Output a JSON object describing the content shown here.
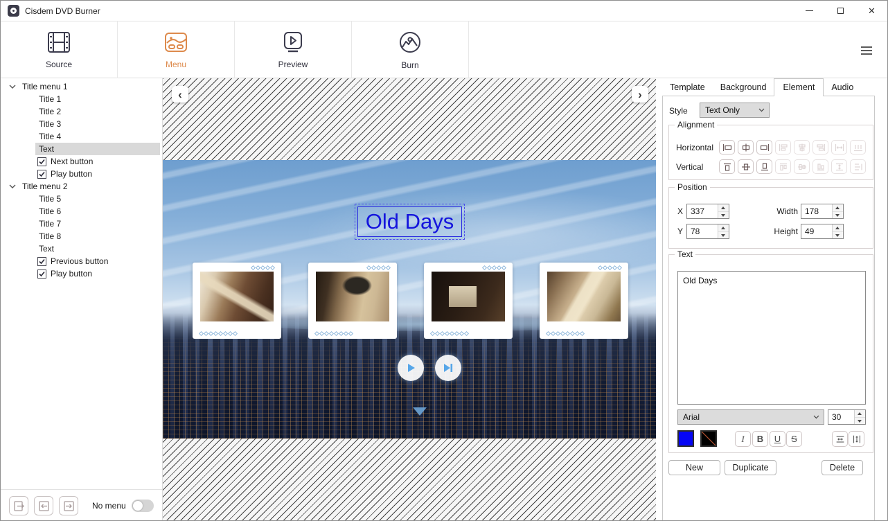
{
  "window": {
    "title": "Cisdem DVD Burner",
    "controls": [
      "minimize-icon",
      "maximize-icon",
      "close-icon"
    ]
  },
  "toolbar": {
    "items": [
      {
        "label": "Source",
        "icon": "filmstrip-icon",
        "active": false
      },
      {
        "label": "Menu",
        "icon": "image-menu-icon",
        "active": true
      },
      {
        "label": "Preview",
        "icon": "play-screen-icon",
        "active": false
      },
      {
        "label": "Burn",
        "icon": "disc-burn-icon",
        "active": false
      }
    ],
    "more_icon": "hamburger-icon"
  },
  "colors": {
    "accent_orange": "#dd8a4c",
    "selection_gray": "#d9d9d9",
    "menu_title_blue": "#1414dd"
  },
  "tree": {
    "groups": [
      {
        "label": "Title menu 1",
        "expanded": true,
        "children": [
          {
            "label": "Title 1"
          },
          {
            "label": "Title 2"
          },
          {
            "label": "Title 3"
          },
          {
            "label": "Title 4"
          },
          {
            "label": "Text",
            "selected": true
          },
          {
            "label": "Next button",
            "checkbox": true,
            "checked": true
          },
          {
            "label": "Play button",
            "checkbox": true,
            "checked": true
          }
        ]
      },
      {
        "label": "Title menu 2",
        "expanded": true,
        "children": [
          {
            "label": "Title 5"
          },
          {
            "label": "Title 6"
          },
          {
            "label": "Title 7"
          },
          {
            "label": "Title 8"
          },
          {
            "label": "Text"
          },
          {
            "label": "Previous button",
            "checkbox": true,
            "checked": true
          },
          {
            "label": "Play button",
            "checkbox": true,
            "checked": true
          }
        ]
      }
    ]
  },
  "bottom_bar": {
    "label": "No menu",
    "toggle_on": false
  },
  "preview": {
    "menu_title": "Old Days",
    "thumbnails": [
      "old-building",
      "old-truck",
      "old-tv",
      "old-telephone"
    ]
  },
  "panel": {
    "tabs": [
      {
        "label": "Template"
      },
      {
        "label": "Background"
      },
      {
        "label": "Element",
        "active": true
      },
      {
        "label": "Audio"
      }
    ],
    "style_label": "Style",
    "style_value": "Text Only",
    "alignment": {
      "title": "Alignment",
      "horizontal": "Horizontal",
      "vertical": "Vertical"
    },
    "position": {
      "title": "Position",
      "x_label": "X",
      "x": "337",
      "y_label": "Y",
      "y": "78",
      "width_label": "Width",
      "width": "178",
      "height_label": "Height",
      "height": "49"
    },
    "text": {
      "title": "Text",
      "content": "Old Days",
      "font": "Arial",
      "size": "30",
      "text_color": "#0505f5",
      "outline_color": "#000000"
    },
    "actions": {
      "new": "New",
      "duplicate": "Duplicate",
      "delete": "Delete"
    }
  }
}
